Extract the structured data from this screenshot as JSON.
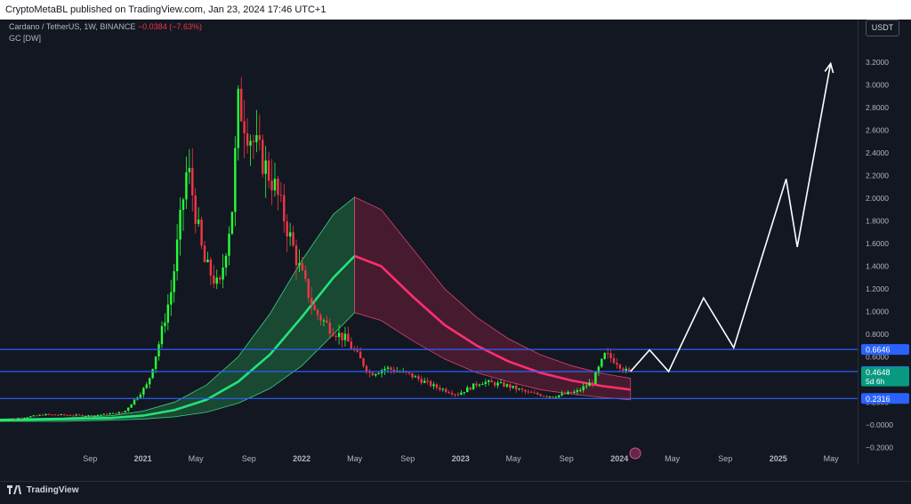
{
  "header": {
    "published_line": "CryptoMetaBL published on TradingView.com, Jan 23, 2024 17:46 UTC+1"
  },
  "legend": {
    "symbol": "Cardano / TetherUS, 1W, BINANCE",
    "change": "−0.0384 (−7.63%)",
    "indicator": "GC [DW]"
  },
  "currency_button": "USDT",
  "brand": "TradingView",
  "colors": {
    "background": "#131722",
    "up": "#26ff3a",
    "down": "#f23645",
    "curve_green": "#22e37a",
    "curve_red": "#ff2f6e",
    "band_green": "#1c5a3a",
    "band_red": "#5a1d34",
    "hline": "#2962ff",
    "projection": "#ffffff"
  },
  "chart_data": {
    "type": "line",
    "instrument": "ADAUSDT weekly",
    "y_axis": {
      "ticks": [
        "−0.2000",
        "−0.0000",
        "0.2000",
        "0.4000",
        "0.6000",
        "0.8000",
        "1.0000",
        "1.2000",
        "1.4000",
        "1.6000",
        "1.8000",
        "2.0000",
        "2.2000",
        "2.4000",
        "2.6000",
        "2.8000",
        "3.0000",
        "3.2000"
      ],
      "tick_values": [
        -0.2,
        0,
        0.2,
        0.4,
        0.6,
        0.8,
        1.0,
        1.2,
        1.4,
        1.6,
        1.8,
        2.0,
        2.2,
        2.4,
        2.6,
        2.8,
        3.0,
        3.2
      ],
      "ylim": [
        -0.3,
        3.5
      ]
    },
    "x_axis": {
      "tick_labels": [
        "Sep",
        "2021",
        "May",
        "Sep",
        "2022",
        "May",
        "Sep",
        "2023",
        "May",
        "Sep",
        "2024",
        "May",
        "Sep",
        "2025",
        "May"
      ],
      "tick_dates": [
        2020.667,
        2021.0,
        2021.333,
        2021.667,
        2022.0,
        2022.333,
        2022.667,
        2023.0,
        2023.333,
        2023.667,
        2024.0,
        2024.333,
        2024.667,
        2025.0,
        2025.333
      ],
      "xlim": [
        2020.1,
        2025.5
      ]
    },
    "horizontal_levels": [
      {
        "value": 0.6646,
        "label": "0.6646"
      },
      {
        "value": 0.4697,
        "label": "0.4697"
      },
      {
        "value": 0.2316,
        "label": "0.2316"
      }
    ],
    "price_tag": {
      "value": 0.4648,
      "label": "0.4648",
      "countdown": "5d 6h"
    },
    "gaussian_channel": {
      "peak_date": 2022.333,
      "center": {
        "x": [
          2020.1,
          2020.5,
          2020.8,
          2021.0,
          2021.2,
          2021.4,
          2021.6,
          2021.8,
          2022.0,
          2022.2,
          2022.333,
          2022.5,
          2022.7,
          2022.9,
          2023.1,
          2023.3,
          2023.5,
          2023.7,
          2023.9,
          2024.07
        ],
        "y": [
          0.04,
          0.05,
          0.06,
          0.08,
          0.13,
          0.22,
          0.38,
          0.62,
          0.95,
          1.3,
          1.49,
          1.4,
          1.13,
          0.88,
          0.7,
          0.56,
          0.46,
          0.39,
          0.34,
          0.31
        ]
      },
      "upper": {
        "x": [
          2020.1,
          2020.5,
          2020.8,
          2021.0,
          2021.2,
          2021.4,
          2021.6,
          2021.8,
          2022.0,
          2022.2,
          2022.333,
          2022.5,
          2022.7,
          2022.9,
          2023.1,
          2023.3,
          2023.5,
          2023.7,
          2023.9,
          2024.07
        ],
        "y": [
          0.05,
          0.06,
          0.08,
          0.12,
          0.2,
          0.35,
          0.6,
          0.98,
          1.45,
          1.86,
          2.01,
          1.9,
          1.55,
          1.2,
          0.95,
          0.76,
          0.62,
          0.52,
          0.45,
          0.41
        ]
      },
      "lower": {
        "x": [
          2020.1,
          2020.5,
          2020.8,
          2021.0,
          2021.2,
          2021.4,
          2021.6,
          2021.8,
          2022.0,
          2022.2,
          2022.333,
          2022.5,
          2022.7,
          2022.9,
          2023.1,
          2023.3,
          2023.5,
          2023.7,
          2023.9,
          2024.07
        ],
        "y": [
          0.03,
          0.03,
          0.04,
          0.05,
          0.07,
          0.11,
          0.19,
          0.32,
          0.52,
          0.8,
          0.99,
          0.92,
          0.74,
          0.58,
          0.46,
          0.38,
          0.31,
          0.27,
          0.24,
          0.22
        ]
      }
    },
    "price_path": {
      "x": [
        2020.1,
        2020.4,
        2020.7,
        2020.9,
        2021.05,
        2021.12,
        2021.2,
        2021.3,
        2021.4,
        2021.5,
        2021.58,
        2021.62,
        2021.68,
        2021.75,
        2021.85,
        2022.0,
        2022.1,
        2022.2,
        2022.3,
        2022.4,
        2022.45,
        2022.55,
        2022.7,
        2022.85,
        2023.0,
        2023.15,
        2023.3,
        2023.45,
        2023.6,
        2023.75,
        2023.85,
        2023.93,
        2024.0,
        2024.07
      ],
      "y": [
        0.03,
        0.09,
        0.08,
        0.11,
        0.36,
        0.72,
        1.2,
        2.3,
        1.45,
        1.2,
        1.9,
        2.85,
        2.6,
        2.4,
        2.1,
        1.4,
        1.0,
        0.85,
        0.75,
        0.55,
        0.45,
        0.5,
        0.44,
        0.34,
        0.27,
        0.38,
        0.35,
        0.28,
        0.25,
        0.29,
        0.38,
        0.62,
        0.56,
        0.46
      ]
    },
    "projection": {
      "x": [
        2024.07,
        2024.19,
        2024.31,
        2024.53,
        2024.72,
        2025.05,
        2025.12,
        2025.33
      ],
      "y": [
        0.47,
        0.66,
        0.47,
        1.12,
        0.68,
        2.17,
        1.57,
        3.19
      ]
    }
  }
}
